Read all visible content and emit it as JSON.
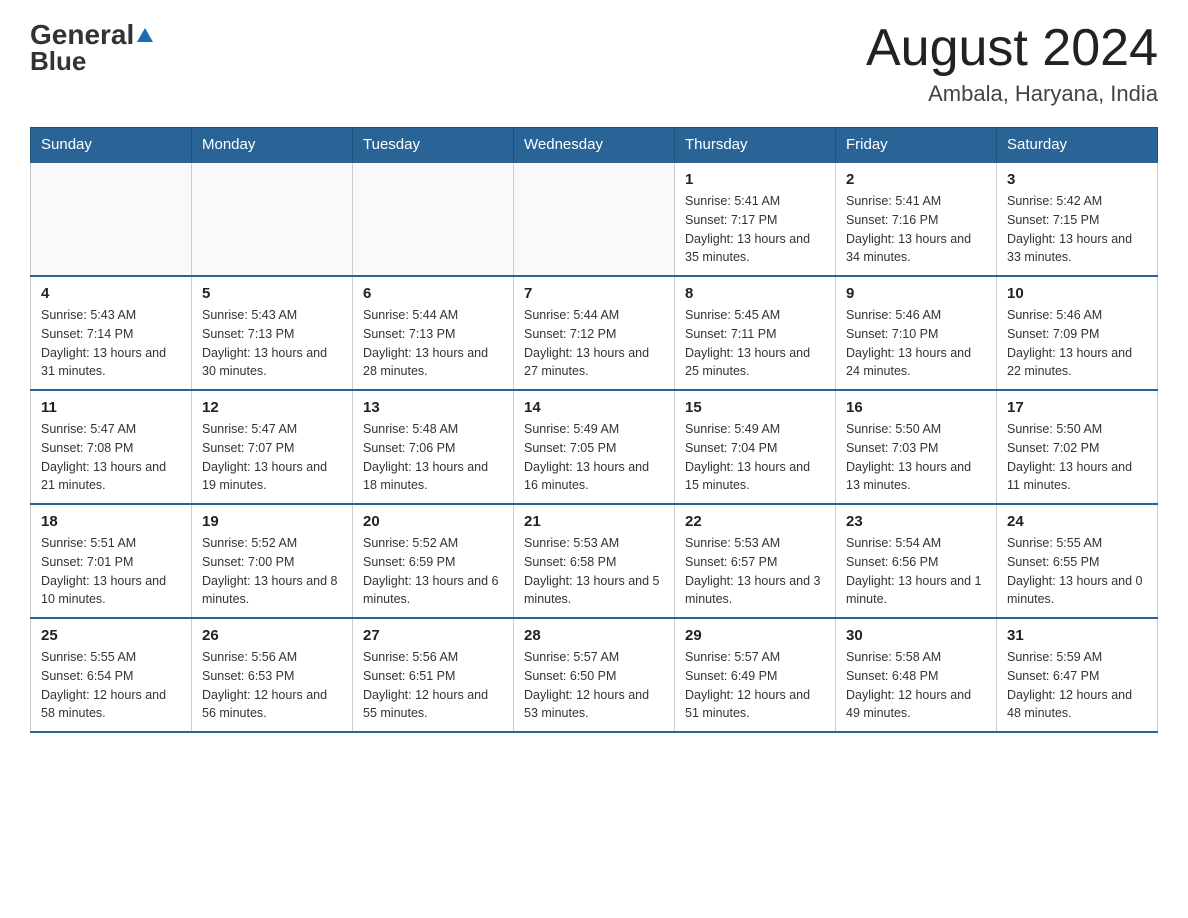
{
  "logo": {
    "text_general": "General",
    "text_blue": "Blue"
  },
  "header": {
    "month_title": "August 2024",
    "location": "Ambala, Haryana, India"
  },
  "days_of_week": [
    "Sunday",
    "Monday",
    "Tuesday",
    "Wednesday",
    "Thursday",
    "Friday",
    "Saturday"
  ],
  "weeks": [
    [
      {
        "day": "",
        "info": ""
      },
      {
        "day": "",
        "info": ""
      },
      {
        "day": "",
        "info": ""
      },
      {
        "day": "",
        "info": ""
      },
      {
        "day": "1",
        "info": "Sunrise: 5:41 AM\nSunset: 7:17 PM\nDaylight: 13 hours and 35 minutes."
      },
      {
        "day": "2",
        "info": "Sunrise: 5:41 AM\nSunset: 7:16 PM\nDaylight: 13 hours and 34 minutes."
      },
      {
        "day": "3",
        "info": "Sunrise: 5:42 AM\nSunset: 7:15 PM\nDaylight: 13 hours and 33 minutes."
      }
    ],
    [
      {
        "day": "4",
        "info": "Sunrise: 5:43 AM\nSunset: 7:14 PM\nDaylight: 13 hours and 31 minutes."
      },
      {
        "day": "5",
        "info": "Sunrise: 5:43 AM\nSunset: 7:13 PM\nDaylight: 13 hours and 30 minutes."
      },
      {
        "day": "6",
        "info": "Sunrise: 5:44 AM\nSunset: 7:13 PM\nDaylight: 13 hours and 28 minutes."
      },
      {
        "day": "7",
        "info": "Sunrise: 5:44 AM\nSunset: 7:12 PM\nDaylight: 13 hours and 27 minutes."
      },
      {
        "day": "8",
        "info": "Sunrise: 5:45 AM\nSunset: 7:11 PM\nDaylight: 13 hours and 25 minutes."
      },
      {
        "day": "9",
        "info": "Sunrise: 5:46 AM\nSunset: 7:10 PM\nDaylight: 13 hours and 24 minutes."
      },
      {
        "day": "10",
        "info": "Sunrise: 5:46 AM\nSunset: 7:09 PM\nDaylight: 13 hours and 22 minutes."
      }
    ],
    [
      {
        "day": "11",
        "info": "Sunrise: 5:47 AM\nSunset: 7:08 PM\nDaylight: 13 hours and 21 minutes."
      },
      {
        "day": "12",
        "info": "Sunrise: 5:47 AM\nSunset: 7:07 PM\nDaylight: 13 hours and 19 minutes."
      },
      {
        "day": "13",
        "info": "Sunrise: 5:48 AM\nSunset: 7:06 PM\nDaylight: 13 hours and 18 minutes."
      },
      {
        "day": "14",
        "info": "Sunrise: 5:49 AM\nSunset: 7:05 PM\nDaylight: 13 hours and 16 minutes."
      },
      {
        "day": "15",
        "info": "Sunrise: 5:49 AM\nSunset: 7:04 PM\nDaylight: 13 hours and 15 minutes."
      },
      {
        "day": "16",
        "info": "Sunrise: 5:50 AM\nSunset: 7:03 PM\nDaylight: 13 hours and 13 minutes."
      },
      {
        "day": "17",
        "info": "Sunrise: 5:50 AM\nSunset: 7:02 PM\nDaylight: 13 hours and 11 minutes."
      }
    ],
    [
      {
        "day": "18",
        "info": "Sunrise: 5:51 AM\nSunset: 7:01 PM\nDaylight: 13 hours and 10 minutes."
      },
      {
        "day": "19",
        "info": "Sunrise: 5:52 AM\nSunset: 7:00 PM\nDaylight: 13 hours and 8 minutes."
      },
      {
        "day": "20",
        "info": "Sunrise: 5:52 AM\nSunset: 6:59 PM\nDaylight: 13 hours and 6 minutes."
      },
      {
        "day": "21",
        "info": "Sunrise: 5:53 AM\nSunset: 6:58 PM\nDaylight: 13 hours and 5 minutes."
      },
      {
        "day": "22",
        "info": "Sunrise: 5:53 AM\nSunset: 6:57 PM\nDaylight: 13 hours and 3 minutes."
      },
      {
        "day": "23",
        "info": "Sunrise: 5:54 AM\nSunset: 6:56 PM\nDaylight: 13 hours and 1 minute."
      },
      {
        "day": "24",
        "info": "Sunrise: 5:55 AM\nSunset: 6:55 PM\nDaylight: 13 hours and 0 minutes."
      }
    ],
    [
      {
        "day": "25",
        "info": "Sunrise: 5:55 AM\nSunset: 6:54 PM\nDaylight: 12 hours and 58 minutes."
      },
      {
        "day": "26",
        "info": "Sunrise: 5:56 AM\nSunset: 6:53 PM\nDaylight: 12 hours and 56 minutes."
      },
      {
        "day": "27",
        "info": "Sunrise: 5:56 AM\nSunset: 6:51 PM\nDaylight: 12 hours and 55 minutes."
      },
      {
        "day": "28",
        "info": "Sunrise: 5:57 AM\nSunset: 6:50 PM\nDaylight: 12 hours and 53 minutes."
      },
      {
        "day": "29",
        "info": "Sunrise: 5:57 AM\nSunset: 6:49 PM\nDaylight: 12 hours and 51 minutes."
      },
      {
        "day": "30",
        "info": "Sunrise: 5:58 AM\nSunset: 6:48 PM\nDaylight: 12 hours and 49 minutes."
      },
      {
        "day": "31",
        "info": "Sunrise: 5:59 AM\nSunset: 6:47 PM\nDaylight: 12 hours and 48 minutes."
      }
    ]
  ]
}
